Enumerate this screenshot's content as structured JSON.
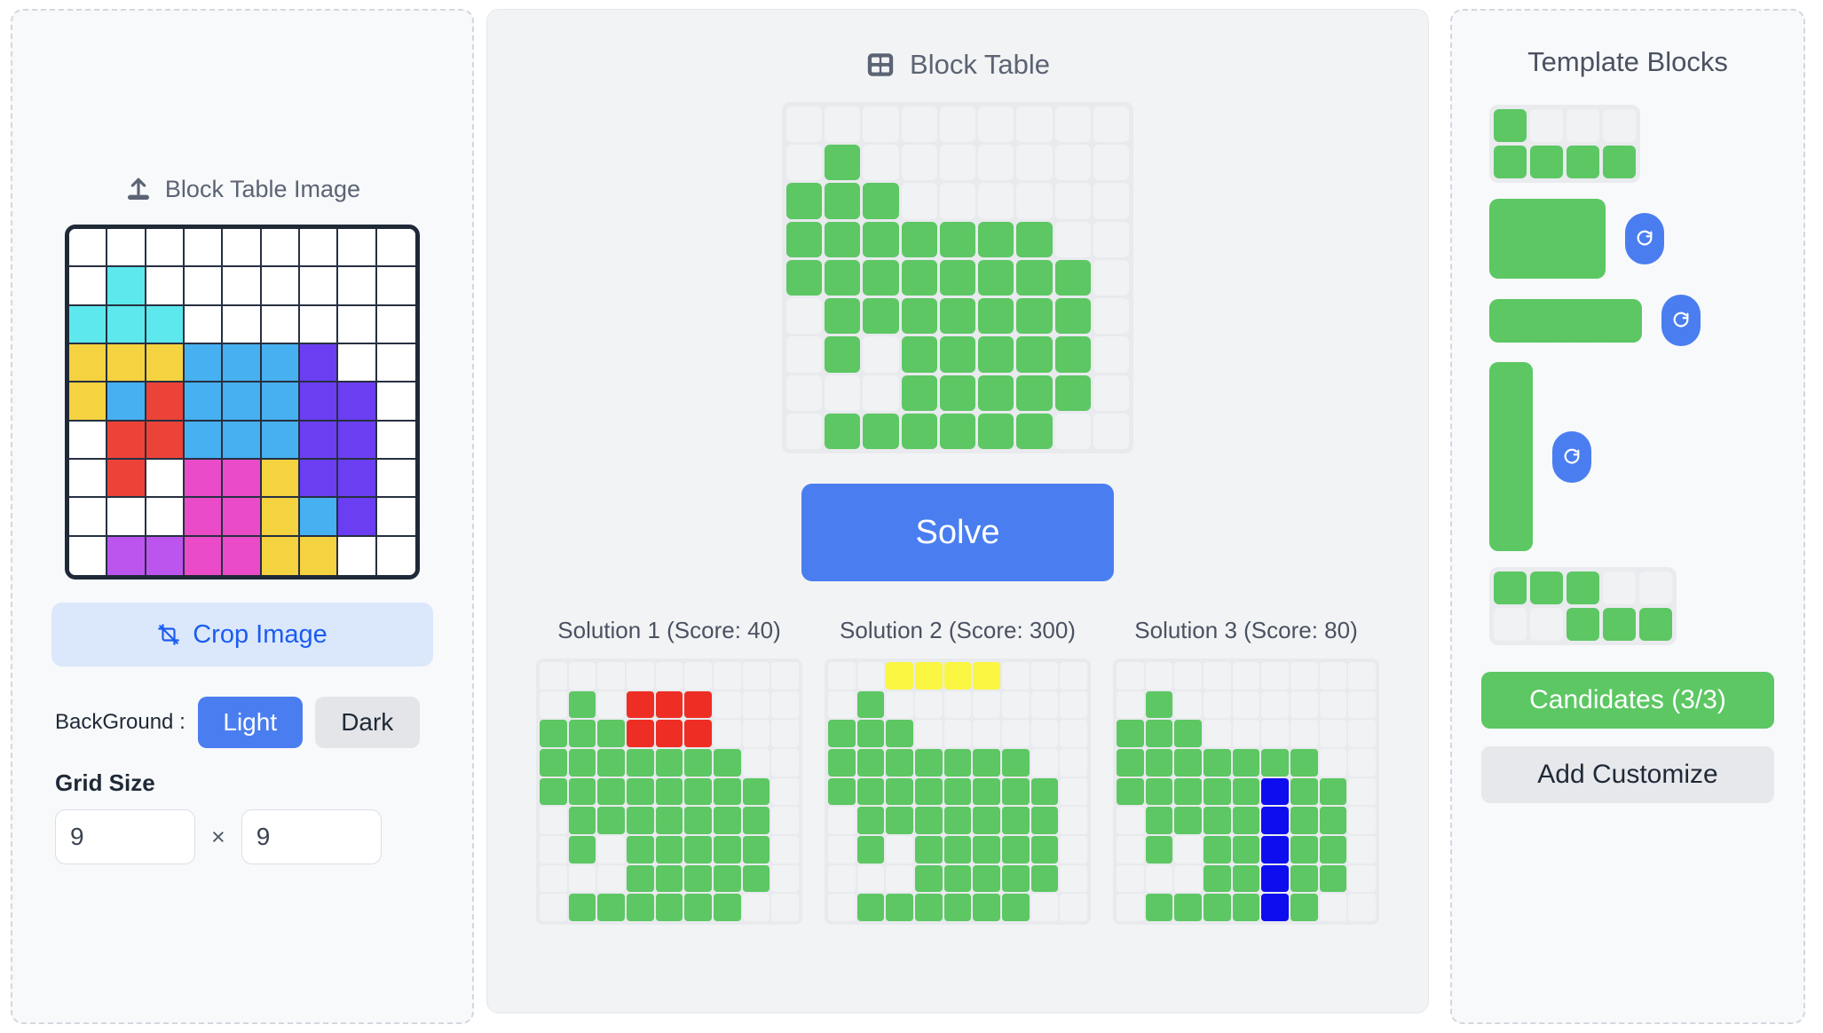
{
  "left": {
    "upload_label": "Block Table Image",
    "upload_icon": "upload-icon",
    "crop_label": "Crop Image",
    "crop_icon": "crop-icon",
    "background_label": "BackGround :",
    "background_options": [
      "Light",
      "Dark"
    ],
    "background_selected": "Light",
    "grid_size_label": "Grid Size",
    "grid_width": "9",
    "grid_height": "9",
    "times_symbol": "×",
    "image_palette": {
      "empty": "#ffffff",
      "cyan": "#5ce8ec",
      "yellow": "#f5d23f",
      "blue": "#46b0f0",
      "red": "#ec4339",
      "purple": "#6b3ef2",
      "magenta": "#ea4bc8"
    },
    "image_grid": [
      [
        "e",
        "e",
        "e",
        "e",
        "e",
        "e",
        "e",
        "e",
        "e"
      ],
      [
        "e",
        "c",
        "e",
        "e",
        "e",
        "e",
        "e",
        "e",
        "e"
      ],
      [
        "c",
        "c",
        "c",
        "e",
        "e",
        "e",
        "e",
        "e",
        "e"
      ],
      [
        "y",
        "y",
        "y",
        "b",
        "b",
        "b",
        "p",
        "e",
        "e"
      ],
      [
        "y",
        "b",
        "r",
        "b",
        "b",
        "b",
        "p",
        "p",
        "e"
      ],
      [
        "e",
        "r",
        "r",
        "b",
        "b",
        "b",
        "p",
        "p",
        "e"
      ],
      [
        "e",
        "r",
        "e",
        "m",
        "m",
        "y",
        "p",
        "p",
        "e"
      ],
      [
        "e",
        "e",
        "e",
        "m",
        "m",
        "y",
        "b",
        "p",
        "e"
      ],
      [
        "e",
        "v",
        "v",
        "m",
        "m",
        "y",
        "y",
        "e",
        "e"
      ]
    ]
  },
  "middle": {
    "title": "Block Table",
    "title_icon": "table-icon",
    "solve_label": "Solve",
    "board": [
      [
        0,
        0,
        0,
        0,
        0,
        0,
        0,
        0,
        0
      ],
      [
        0,
        1,
        0,
        0,
        0,
        0,
        0,
        0,
        0
      ],
      [
        1,
        1,
        1,
        0,
        0,
        0,
        0,
        0,
        0
      ],
      [
        1,
        1,
        1,
        1,
        1,
        1,
        1,
        0,
        0
      ],
      [
        1,
        1,
        1,
        1,
        1,
        1,
        1,
        1,
        0
      ],
      [
        0,
        1,
        1,
        1,
        1,
        1,
        1,
        1,
        0
      ],
      [
        0,
        1,
        0,
        1,
        1,
        1,
        1,
        1,
        0
      ],
      [
        0,
        0,
        0,
        1,
        1,
        1,
        1,
        1,
        0
      ],
      [
        0,
        1,
        1,
        1,
        1,
        1,
        1,
        0,
        0
      ]
    ],
    "solutions": [
      {
        "title": "Solution 1 (Score: 40)",
        "score": 40,
        "grid": [
          [
            "",
            "",
            "",
            "",
            "",
            "",
            "",
            "",
            ""
          ],
          [
            "",
            "g",
            "",
            "r",
            "r",
            "r",
            "",
            "",
            ""
          ],
          [
            "g",
            "g",
            "g",
            "r",
            "r",
            "r",
            "",
            "",
            ""
          ],
          [
            "g",
            "g",
            "g",
            "g",
            "g",
            "g",
            "g",
            "",
            ""
          ],
          [
            "g",
            "g",
            "g",
            "g",
            "g",
            "g",
            "g",
            "g",
            ""
          ],
          [
            "",
            "g",
            "g",
            "g",
            "g",
            "g",
            "g",
            "g",
            ""
          ],
          [
            "",
            "g",
            "",
            "g",
            "g",
            "g",
            "g",
            "g",
            ""
          ],
          [
            "",
            "",
            "",
            "g",
            "g",
            "g",
            "g",
            "g",
            ""
          ],
          [
            "",
            "g",
            "g",
            "g",
            "g",
            "g",
            "g",
            "",
            ""
          ]
        ]
      },
      {
        "title": "Solution 2 (Score: 300)",
        "score": 300,
        "grid": [
          [
            "",
            "",
            "y",
            "y",
            "y",
            "y",
            "",
            "",
            ""
          ],
          [
            "",
            "g",
            "",
            "",
            "",
            "",
            "",
            "",
            ""
          ],
          [
            "g",
            "g",
            "g",
            "",
            "",
            "",
            "",
            "",
            ""
          ],
          [
            "g",
            "g",
            "g",
            "g",
            "g",
            "g",
            "g",
            "",
            ""
          ],
          [
            "g",
            "g",
            "g",
            "g",
            "g",
            "g",
            "g",
            "g",
            ""
          ],
          [
            "",
            "g",
            "g",
            "g",
            "g",
            "g",
            "g",
            "g",
            ""
          ],
          [
            "",
            "g",
            "",
            "g",
            "g",
            "g",
            "g",
            "g",
            ""
          ],
          [
            "",
            "",
            "",
            "g",
            "g",
            "g",
            "g",
            "g",
            ""
          ],
          [
            "",
            "g",
            "g",
            "g",
            "g",
            "g",
            "g",
            "",
            ""
          ]
        ]
      },
      {
        "title": "Solution 3 (Score: 80)",
        "score": 80,
        "grid": [
          [
            "",
            "",
            "",
            "",
            "",
            "",
            "",
            "",
            ""
          ],
          [
            "",
            "g",
            "",
            "",
            "",
            "",
            "",
            "",
            ""
          ],
          [
            "g",
            "g",
            "g",
            "",
            "",
            "",
            "",
            "",
            ""
          ],
          [
            "g",
            "g",
            "g",
            "g",
            "g",
            "g",
            "g",
            "",
            ""
          ],
          [
            "g",
            "g",
            "g",
            "g",
            "g",
            "b",
            "g",
            "g",
            ""
          ],
          [
            "",
            "g",
            "g",
            "g",
            "g",
            "b",
            "g",
            "g",
            ""
          ],
          [
            "",
            "g",
            "",
            "g",
            "g",
            "b",
            "g",
            "g",
            ""
          ],
          [
            "",
            "",
            "",
            "g",
            "g",
            "b",
            "g",
            "g",
            ""
          ],
          [
            "",
            "g",
            "g",
            "g",
            "g",
            "b",
            "g",
            "",
            ""
          ]
        ]
      }
    ]
  },
  "right": {
    "title": "Template Blocks",
    "rotate_icon": "rotate-icon",
    "candidates_label": "Candidates (3/3)",
    "add_customize_label": "Add Customize",
    "blocks": [
      {
        "name": "block-j-piece",
        "selected": false,
        "rotatable": false,
        "cols": 4,
        "cells": [
          1,
          0,
          0,
          0,
          1,
          1,
          1,
          1
        ]
      },
      {
        "name": "block-2x3-rect",
        "selected": true,
        "rotatable": true,
        "cols": 3,
        "cells": [
          1,
          1,
          1,
          1,
          1,
          1
        ]
      },
      {
        "name": "block-1x4-line",
        "selected": true,
        "rotatable": true,
        "cols": 4,
        "cells": [
          1,
          1,
          1,
          1
        ]
      },
      {
        "name": "block-5x1-vertical-line",
        "selected": true,
        "rotatable": true,
        "cols": 1,
        "cells": [
          1,
          1,
          1,
          1,
          1
        ]
      },
      {
        "name": "block-s-piece",
        "selected": false,
        "rotatable": false,
        "cols": 5,
        "cells": [
          1,
          1,
          1,
          0,
          0,
          0,
          0,
          1,
          1,
          1
        ]
      }
    ]
  }
}
